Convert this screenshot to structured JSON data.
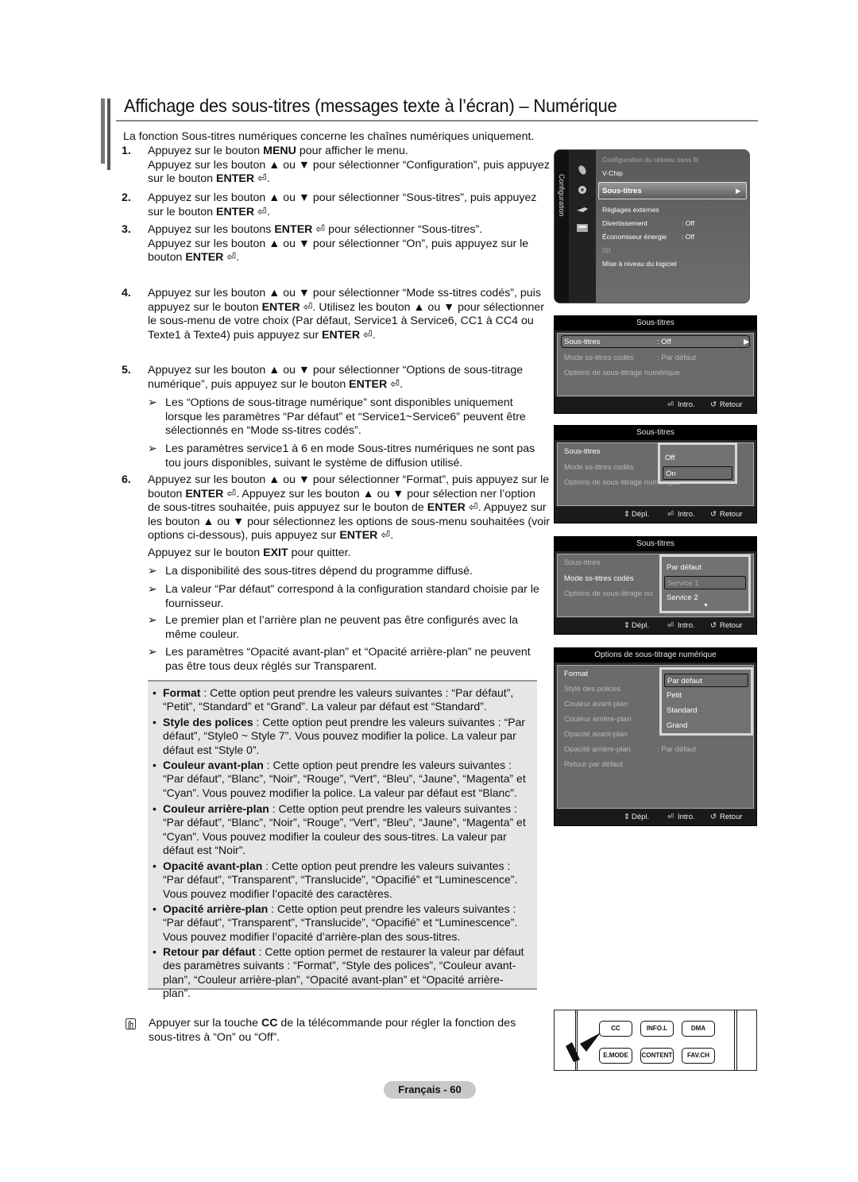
{
  "title": "Affichage des sous-titres (messages texte à l’écran) – Numérique",
  "intro": "La fonction Sous-titres numériques concerne les chaînes numériques uniquement.",
  "steps": [
    {
      "num": "1.",
      "lines": [
        "Appuyez sur le bouton <b>MENU</b> pour afficher le menu.",
        "Appuyez sur les bouton ▲ ou ▼ pour sélectionner “Configuration”, puis appuyez sur le bouton <b>ENTER</b> ⏎."
      ]
    },
    {
      "num": "2.",
      "lines": [
        "Appuyez sur les bouton ▲ ou ▼ pour sélectionner “Sous-titres”, puis appuyez sur le bouton <b>ENTER</b> ⏎."
      ]
    },
    {
      "num": "3.",
      "lines": [
        "Appuyez sur les boutons <b>ENTER</b> ⏎ pour sélectionner “Sous-titres”.",
        "Appuyez sur les bouton ▲ ou ▼ pour sélectionner “On”, puis appuyez sur le bouton <b>ENTER</b> ⏎."
      ]
    },
    {
      "num": "4.",
      "lines": [
        "Appuyez sur les bouton ▲ ou ▼ pour sélectionner “Mode ss-titres codés”, puis appuyez sur le bouton <b>ENTER</b> ⏎. Utilisez les bouton ▲ ou ▼ pour sélectionner le sous-menu de votre choix (Par défaut, Service1 à Service6, CC1 à CC4 ou Texte1 à Texte4) puis appuyez sur <b>ENTER</b> ⏎."
      ]
    },
    {
      "num": "5.",
      "lines": [
        "Appuyez sur les bouton ▲ ou ▼ pour sélectionner “Options de sous-titrage numérique”, puis appuyez sur le bouton <b>ENTER</b> ⏎."
      ]
    },
    {
      "num": "6.",
      "lines": [
        "Appuyez sur les bouton ▲ ou ▼ pour sélectionner “Format”, puis appuyez sur le bouton <b>ENTER</b> ⏎. Appuyez sur les bouton ▲ ou ▼ pour sélection ner l’option de sous-titres souhaitée, puis appuyez sur le bouton de <b>ENTER</b> ⏎. Appuyez sur les bouton ▲ ou ▼ pour sélectionnez les options de sous-menu souhaitées (voir options ci-dessous), puis appuyez sur <b>ENTER</b> ⏎."
      ]
    }
  ],
  "step5_notes": [
    "Les “Options de sous-titrage numérique” sont disponibles uniquement lorsque les paramètres “Par défaut” et “Service1~Service6” peuvent être sélectionnés en “Mode ss-titres codés”.",
    "Les paramètres service1 à 6 en mode Sous-titres numériques ne sont pas tou jours disponibles, suivant le système de diffusion utilisé."
  ],
  "exit_line": "Appuyez sur le bouton <b>EXIT</b> pour quitter.",
  "step6_notes": [
    "La disponibilité des sous-titres dépend du programme diffusé.",
    "La valeur “Par défaut” correspond à la configuration standard choisie par le fournisseur.",
    "Le premier plan et l’arrière plan ne peuvent pas être configurés avec la même couleur.",
    "Les paramètres “Opacité avant-plan” et “Opacité arrière-plan” ne peuvent pas être tous deux réglés sur Transparent."
  ],
  "arrow_glyph": "➢",
  "bullet_glyph": "•",
  "options": [
    {
      "term": "Format",
      "desc": " : Cette option peut prendre les valeurs suivantes : “Par défaut”, “Petit”, “Standard” et “Grand”. La valeur par défaut est “Standard”."
    },
    {
      "term": "Style des polices",
      "desc": " : Cette option peut prendre les valeurs suivantes : “Par défaut”, “Style0 ~ Style 7”. Vous pouvez modifier la police. La valeur par défaut est “Style 0”."
    },
    {
      "term": "Couleur avant-plan",
      "desc": " : Cette option peut prendre les valeurs suivantes : “Par défaut”, “Blanc”, “Noir”, “Rouge”, “Vert”, “Bleu”, “Jaune”, “Magenta” et “Cyan”. Vous pouvez modifier la police. La valeur par défaut est “Blanc”."
    },
    {
      "term": "Couleur arrière-plan",
      "desc": " : Cette option peut prendre les valeurs suivantes : “Par défaut”, “Blanc”, “Noir”, “Rouge”, “Vert”, “Bleu”, “Jaune”, “Magenta” et “Cyan”. Vous pouvez modifier la couleur des sous-titres. La valeur par défaut est “Noir”."
    },
    {
      "term": "Opacité avant-plan",
      "desc": " : Cette option peut prendre les valeurs suivantes : “Par défaut”, “Transparent”, “Translucide”, “Opacifié” et “Luminescence”. Vous pouvez modifier l’opacité des caractères."
    },
    {
      "term": "Opacité arrière-plan",
      "desc": " : Cette option peut prendre les valeurs suivantes : “Par défaut”, “Transparent”, “Translucide”, “Opacifié” et “Luminescence”. Vous pouvez modifier l’opacité d’arrière-plan des sous-titres."
    },
    {
      "term": "Retour par défaut",
      "desc": " : Cette option permet de restaurer la valeur par défaut des paramètres suivants : “Format”, “Style des polices”, “Couleur avant-plan”, “Couleur arrière-plan”, “Opacité avant-plan” et “Opacité arrière-plan”."
    }
  ],
  "cc_note": "Appuyer sur la touche <b>CC</b> de la télécommande pour régler la fonction des sous-titres à “On” ou “Off”.",
  "page_number": "Français - 60",
  "setup_menu": {
    "category": "Configuration",
    "items": [
      {
        "label": "Configuration du réseau sans fil",
        "value": "",
        "dim": true
      },
      {
        "label": "V-Chip",
        "value": "",
        "dim": false
      },
      {
        "label": "Sous-titres",
        "value": "",
        "dim": false,
        "selected": true
      },
      {
        "label": "Réglages externes",
        "value": "",
        "dim": false
      },
      {
        "label": "Divertissement",
        "value": ": Off",
        "dim": false
      },
      {
        "label": "Économiseur énergie",
        "value": ": Off",
        "dim": false
      },
      {
        "label": "ISI",
        "value": "",
        "dim": true
      },
      {
        "label": "Mise à niveau du logiciel",
        "value": "",
        "dim": false
      }
    ],
    "arrow": "▶"
  },
  "screen_a": {
    "header": "Sous-titres",
    "rows": [
      {
        "label": "Sous-titres",
        "value": ": Off"
      },
      {
        "label": "Mode ss-titres codés",
        "value": ": Par défaut"
      },
      {
        "label": "Options de sous-titrage numérique",
        "value": ""
      }
    ],
    "footer": {
      "enter": "Intro.",
      "return": "Retour"
    }
  },
  "screen_b": {
    "header": "Sous-titres",
    "rows": [
      "Sous-titres",
      "Mode ss-titres codés",
      "Options de sous-titrage numérique"
    ],
    "popup": [
      "Off",
      "On"
    ],
    "popup_selected": 1,
    "footer": {
      "move": "Dépl.",
      "enter": "Intro.",
      "return": "Retour"
    }
  },
  "screen_c": {
    "header": "Sous-titres",
    "rows": [
      "Sous-titres",
      "Mode ss-titres codés",
      "Options de sous-titrage nu"
    ],
    "popup": [
      "Par défaut",
      "Service 1",
      "Service 2"
    ],
    "popup_selected": 1,
    "more": "▼",
    "footer": {
      "move": "Dépl.",
      "enter": "Intro.",
      "return": "Retour"
    }
  },
  "screen_d": {
    "header": "Options de sous-titrage numérique",
    "rows": [
      {
        "label": "Format",
        "value": ""
      },
      {
        "label": "Style des polices",
        "value": ""
      },
      {
        "label": "Couleur avant-plan",
        "value": ""
      },
      {
        "label": "Couleur arrière-plan",
        "value": ""
      },
      {
        "label": "Opacité avant-plan",
        "value": ""
      },
      {
        "label": "Opacité arrière-plan",
        "value": ": Par défaut"
      },
      {
        "label": "Retour par défaut",
        "value": ""
      }
    ],
    "popup": [
      "Par défaut",
      "Petit",
      "Standard",
      "Grand"
    ],
    "popup_selected": 0,
    "footer": {
      "move": "Dépl.",
      "enter": "Intro.",
      "return": "Retour"
    }
  },
  "remote_keys": [
    "CC",
    "INFO.L",
    "DMA",
    "E.MODE",
    "CONTENT",
    "FAV.CH"
  ]
}
